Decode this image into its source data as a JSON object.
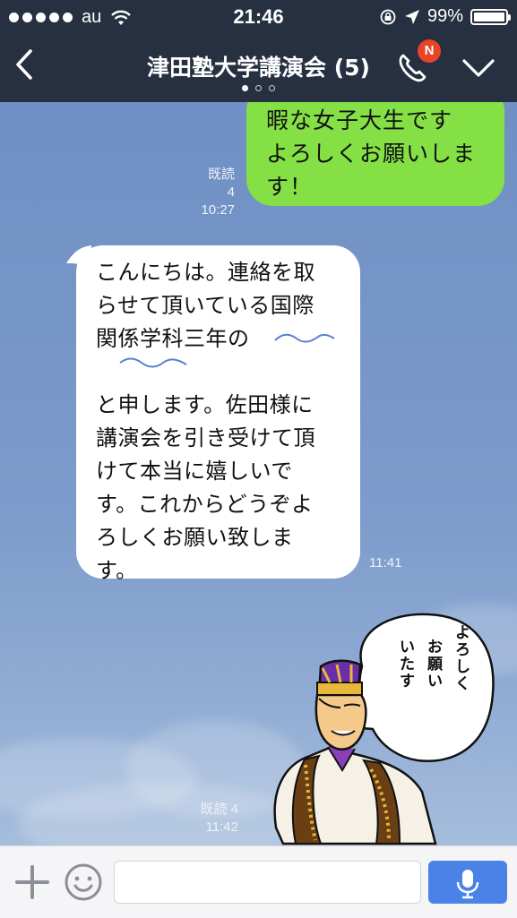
{
  "status_bar": {
    "carrier": "au",
    "time": "21:46",
    "battery_text": "99%",
    "battery_level": 0.99
  },
  "header": {
    "title": "津田塾大学講演会 (5)",
    "call_badge": "N",
    "page_count": 3,
    "active_page": 0,
    "back_icon": "chevron-left-icon",
    "call_icon": "phone-icon",
    "menu_icon": "chevron-down-icon"
  },
  "messages": [
    {
      "sender": "me",
      "text": "暇な女子大生です\nよろしくお願いしま\nす！",
      "read": "既読 4",
      "time": "10:27",
      "color": "#84e045"
    },
    {
      "sender": "other",
      "text": "こんにちは。連絡を取\nらせて頂いている国際\n関係学科三年の\n\nと申します。佐田様に\n講演会を引き受けて頂\nけて本当に嬉しいで\nす。これからどうぞよ\nろしくお願い致しま\nす。",
      "time": "11:41"
    },
    {
      "sender": "me",
      "type": "sticker",
      "sticker_text": "よろしく\nお願い\nいたす",
      "read": "既読 4",
      "time": "11:42"
    }
  ],
  "input_bar": {
    "placeholder": "",
    "value": "",
    "plus_icon": "plus-icon",
    "emoji_icon": "smiley-icon",
    "mic_icon": "microphone-icon",
    "mic_color": "#4a82e8"
  },
  "colors": {
    "header_bg": "#263040",
    "chat_bg": "#7d9cc9",
    "badge": "#e94428"
  }
}
